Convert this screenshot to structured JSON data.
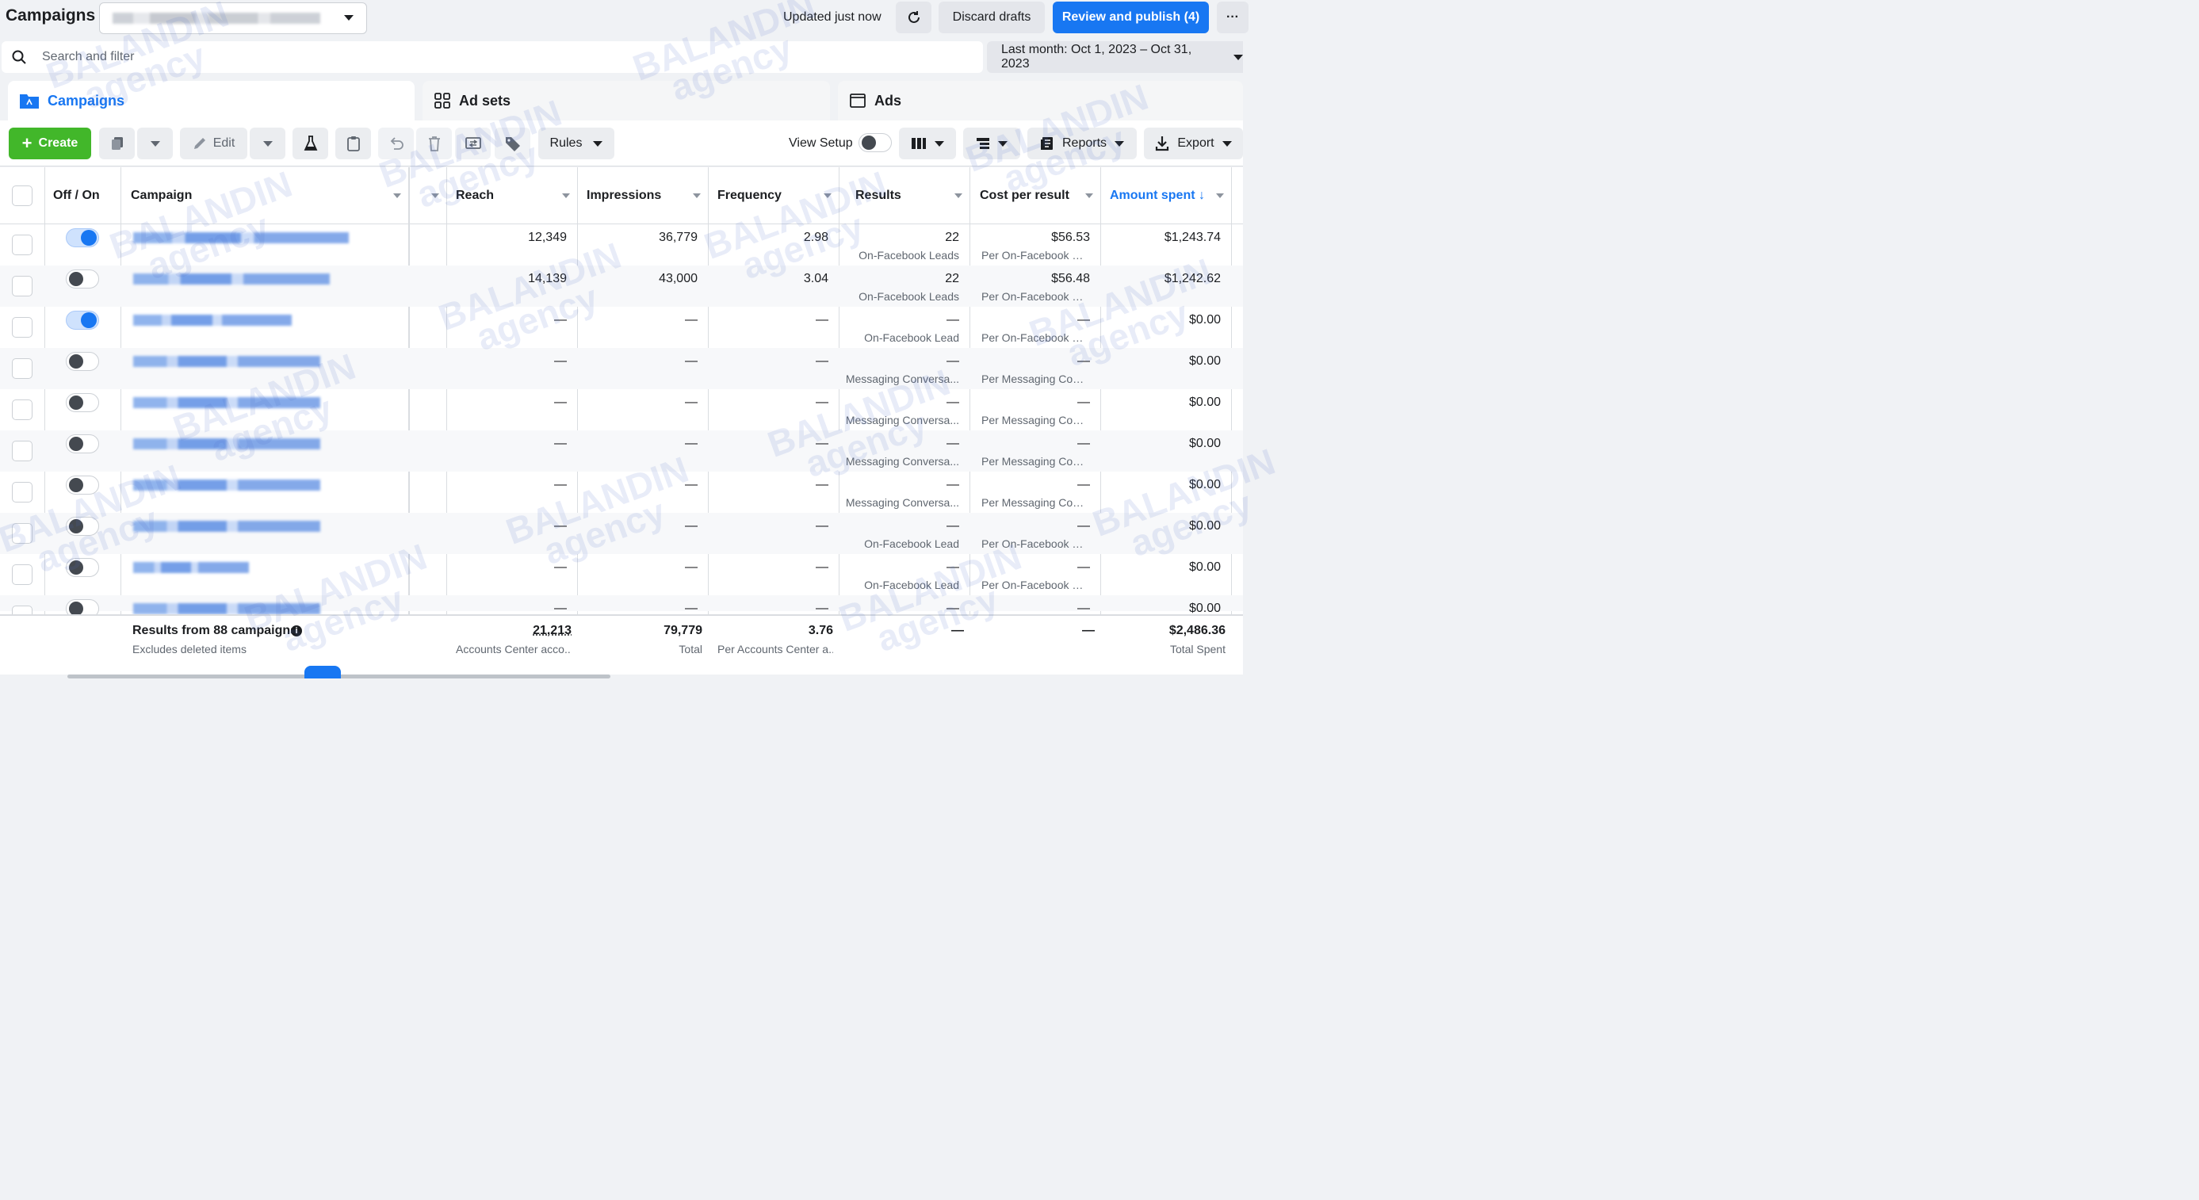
{
  "header": {
    "title": "Campaigns",
    "status": "Updated just now",
    "discard_label": "Discard drafts",
    "publish_label": "Review and publish (4)",
    "more_label": "···"
  },
  "search": {
    "placeholder": "Search and filter"
  },
  "date_range": "Last month: Oct 1, 2023 – Oct 31, 2023",
  "tabs": [
    {
      "label": "Campaigns"
    },
    {
      "label": "Ad sets"
    },
    {
      "label": "Ads"
    }
  ],
  "toolbar": {
    "create_label": "Create",
    "edit_label": "Edit",
    "rules_label": "Rules",
    "view_setup_label": "View Setup",
    "reports_label": "Reports",
    "export_label": "Export"
  },
  "columns": {
    "off_on": "Off / On",
    "campaign": "Campaign",
    "reach": "Reach",
    "impressions": "Impressions",
    "frequency": "Frequency",
    "results": "Results",
    "cost_per_result": "Cost per result",
    "amount_spent": "Amount spent ↓"
  },
  "rows": [
    {
      "on": true,
      "reach": "12,349",
      "impressions": "36,779",
      "frequency": "2.98",
      "results": "22",
      "results_type": "On-Facebook Leads",
      "cpr": "$56.53",
      "cpr_type": "Per On-Facebook Le...",
      "spent": "$1,243.74"
    },
    {
      "on": false,
      "reach": "14,139",
      "impressions": "43,000",
      "frequency": "3.04",
      "results": "22",
      "results_type": "On-Facebook Leads",
      "cpr": "$56.48",
      "cpr_type": "Per On-Facebook Le...",
      "spent": "$1,242.62"
    },
    {
      "on": true,
      "reach": "—",
      "impressions": "—",
      "frequency": "—",
      "results": "—",
      "results_type": "On-Facebook Lead",
      "cpr": "—",
      "cpr_type": "Per On-Facebook Le...",
      "spent": "$0.00"
    },
    {
      "on": false,
      "reach": "—",
      "impressions": "—",
      "frequency": "—",
      "results": "—",
      "results_type": "Messaging Conversa...",
      "cpr": "—",
      "cpr_type": "Per Messaging Conv...",
      "spent": "$0.00"
    },
    {
      "on": false,
      "reach": "—",
      "impressions": "—",
      "frequency": "—",
      "results": "—",
      "results_type": "Messaging Conversa...",
      "cpr": "—",
      "cpr_type": "Per Messaging Conv...",
      "spent": "$0.00"
    },
    {
      "on": false,
      "reach": "—",
      "impressions": "—",
      "frequency": "—",
      "results": "—",
      "results_type": "Messaging Conversa...",
      "cpr": "—",
      "cpr_type": "Per Messaging Conv...",
      "spent": "$0.00"
    },
    {
      "on": false,
      "reach": "—",
      "impressions": "—",
      "frequency": "—",
      "results": "—",
      "results_type": "Messaging Conversa...",
      "cpr": "—",
      "cpr_type": "Per Messaging Conv...",
      "spent": "$0.00"
    },
    {
      "on": false,
      "reach": "—",
      "impressions": "—",
      "frequency": "—",
      "results": "—",
      "results_type": "On-Facebook Lead",
      "cpr": "—",
      "cpr_type": "Per On-Facebook Le...",
      "spent": "$0.00"
    },
    {
      "on": false,
      "reach": "—",
      "impressions": "—",
      "frequency": "—",
      "results": "—",
      "results_type": "On-Facebook Lead",
      "cpr": "—",
      "cpr_type": "Per On-Facebook Le...",
      "spent": "$0.00"
    },
    {
      "on": false,
      "reach": "—",
      "impressions": "—",
      "frequency": "—",
      "results": "—",
      "results_type": "",
      "cpr": "—",
      "cpr_type": "",
      "spent": "$0.00"
    }
  ],
  "footer": {
    "title": "Results from 88 campaigns",
    "subtitle": "Excludes deleted items",
    "reach": "21,213",
    "reach_note": "Accounts Center acco...",
    "impressions": "79,779",
    "impressions_note": "Total",
    "frequency": "3.76",
    "frequency_note": "Per Accounts Center a...",
    "results": "—",
    "cpr": "—",
    "spent": "$2,486.36",
    "spent_note": "Total Spent"
  },
  "watermark": {
    "line1": "BALANDIN",
    "line2": "agency"
  }
}
